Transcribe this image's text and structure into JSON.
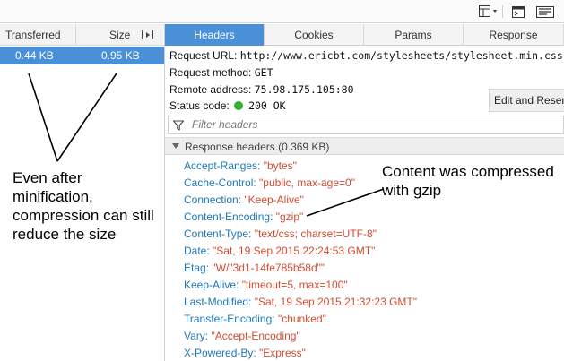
{
  "toolbar": {
    "icons": [
      "layout-dropdown-icon",
      "console-icon",
      "gzip-icon"
    ]
  },
  "list": {
    "columns": {
      "transferred": "Transferred",
      "size": "Size"
    },
    "selected": {
      "transferred": "0.44 KB",
      "size": "0.95 KB"
    }
  },
  "tabs": [
    "Headers",
    "Cookies",
    "Params",
    "Response"
  ],
  "request": {
    "url_label": "Request URL:",
    "url": "http://www.ericbt.com/stylesheets/stylesheet.min.css",
    "method_label": "Request method:",
    "method": "GET",
    "remote_label": "Remote address:",
    "remote": "75.98.175.105:80",
    "status_label": "Status code:",
    "status": "200 OK",
    "status_color": "#2fb12f"
  },
  "edit_resend": "Edit and Resend",
  "filter": {
    "placeholder": "Filter headers"
  },
  "response_section": {
    "title": "Response headers (0.369 KB)"
  },
  "headers": [
    {
      "name": "Accept-Ranges",
      "value": "\"bytes\""
    },
    {
      "name": "Cache-Control",
      "value": "\"public, max-age=0\""
    },
    {
      "name": "Connection",
      "value": "\"Keep-Alive\""
    },
    {
      "name": "Content-Encoding",
      "value": "\"gzip\""
    },
    {
      "name": "Content-Type",
      "value": "\"text/css; charset=UTF-8\""
    },
    {
      "name": "Date",
      "value": "\"Sat, 19 Sep 2015 22:24:53 GMT\""
    },
    {
      "name": "Etag",
      "value": "\"W/\"3d1-14fe785b58d\"\""
    },
    {
      "name": "Keep-Alive",
      "value": "\"timeout=5, max=100\""
    },
    {
      "name": "Last-Modified",
      "value": "\"Sat, 19 Sep 2015 21:32:23 GMT\""
    },
    {
      "name": "Transfer-Encoding",
      "value": "\"chunked\""
    },
    {
      "name": "Vary",
      "value": "\"Accept-Encoding\""
    },
    {
      "name": "X-Powered-By",
      "value": "\"Express\""
    }
  ],
  "annotations": {
    "left": "Even after minification, compression can still reduce the size",
    "right": "Content was compressed with gzip"
  },
  "colors": {
    "accent": "#4a90d9",
    "header_name": "#1f78b4",
    "header_value": "#d24c32"
  }
}
